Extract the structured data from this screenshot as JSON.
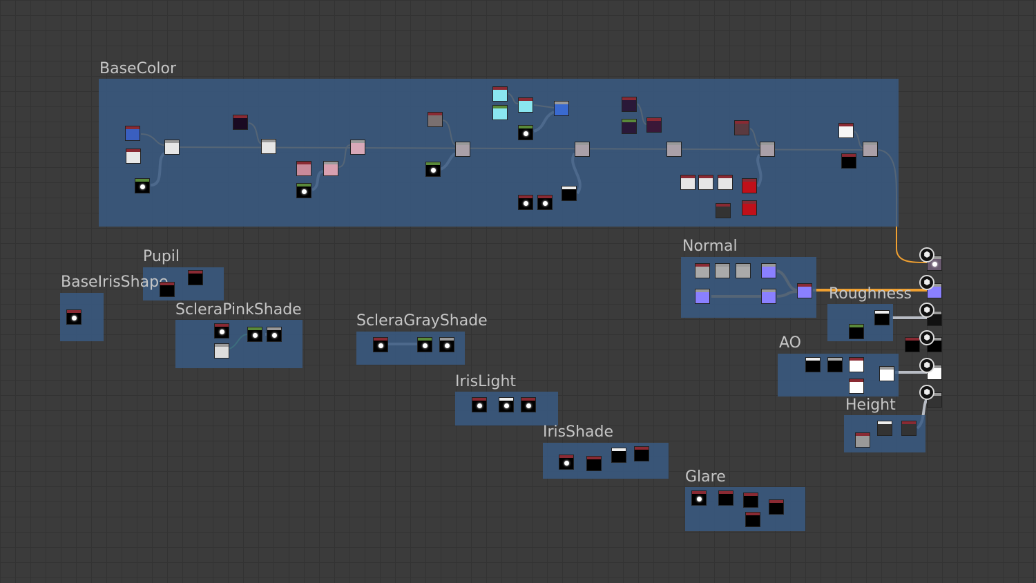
{
  "app": "Substance node graph",
  "frames": [
    {
      "title": "BaseColor"
    },
    {
      "title": "Pupil"
    },
    {
      "title": "BaseIrisShape"
    },
    {
      "title": "ScleraPinkShade"
    },
    {
      "title": "ScleraGrayShade"
    },
    {
      "title": "IrisLight"
    },
    {
      "title": "IrisShade"
    },
    {
      "title": "Glare"
    },
    {
      "title": "Normal"
    },
    {
      "title": "Roughness"
    },
    {
      "title": "AO"
    },
    {
      "title": "Height"
    }
  ],
  "colors": {
    "wire_color": "#f0a030",
    "wire_gray": "#b8bcc4",
    "frame": "#3a5a82"
  }
}
